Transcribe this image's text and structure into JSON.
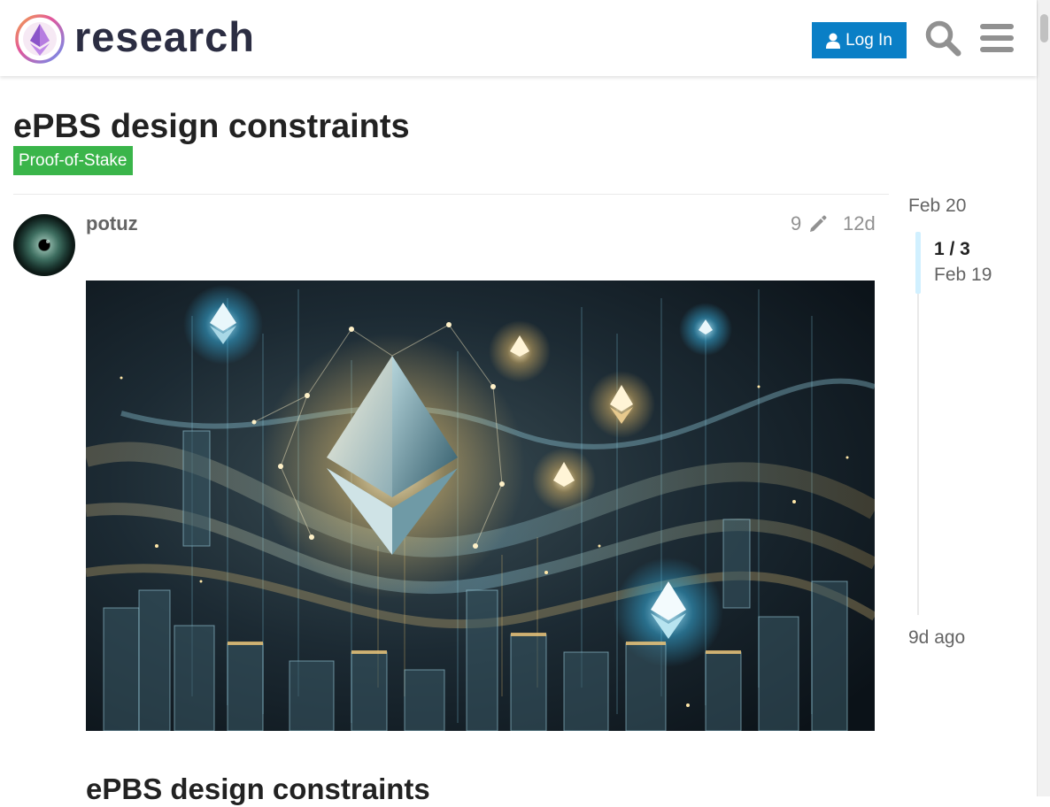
{
  "header": {
    "site_name": "research",
    "login_label": "Log In"
  },
  "topic": {
    "title": "ePBS design constraints",
    "tag": "Proof-of-Stake"
  },
  "post": {
    "username": "potuz",
    "edits": "9",
    "age": "12d",
    "heading": "ePBS design constraints"
  },
  "timeline": {
    "start_date": "Feb 20",
    "position": "1 / 3",
    "current_date": "Feb 19",
    "last_activity": "9d ago"
  },
  "colors": {
    "brand_blue": "#0a7fc6",
    "tag_green": "#3ab54a",
    "timeline_highlight": "#d1f0ff"
  },
  "icons": [
    "research-logo-icon",
    "user-icon",
    "search-icon",
    "hamburger-menu-icon",
    "pencil-icon"
  ]
}
